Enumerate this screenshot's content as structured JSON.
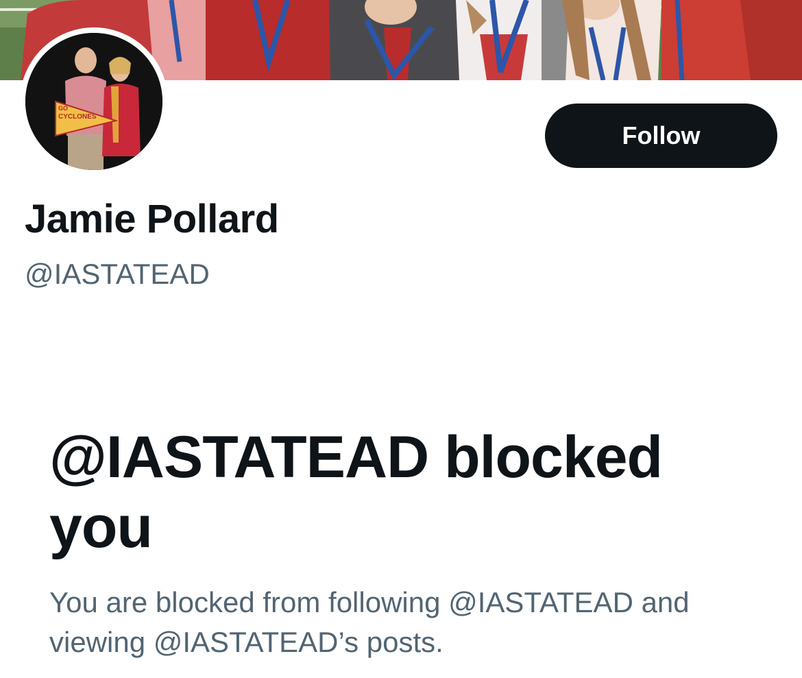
{
  "profile": {
    "display_name": "Jamie Pollard",
    "handle": "@IASTATEAD",
    "avatar_pennant_text": "GO CYCLONES"
  },
  "actions": {
    "follow_label": "Follow"
  },
  "blocked_notice": {
    "title": "@IASTATEAD blocked you",
    "description": "You are blocked from following @IASTATEAD and viewing @IASTATEAD’s posts."
  },
  "colors": {
    "primary_text": "#0f1419",
    "secondary_text": "#536471",
    "button_bg": "#0f1419",
    "button_text": "#ffffff",
    "cardinal": "#b32b2b",
    "gold": "#f1be48"
  }
}
